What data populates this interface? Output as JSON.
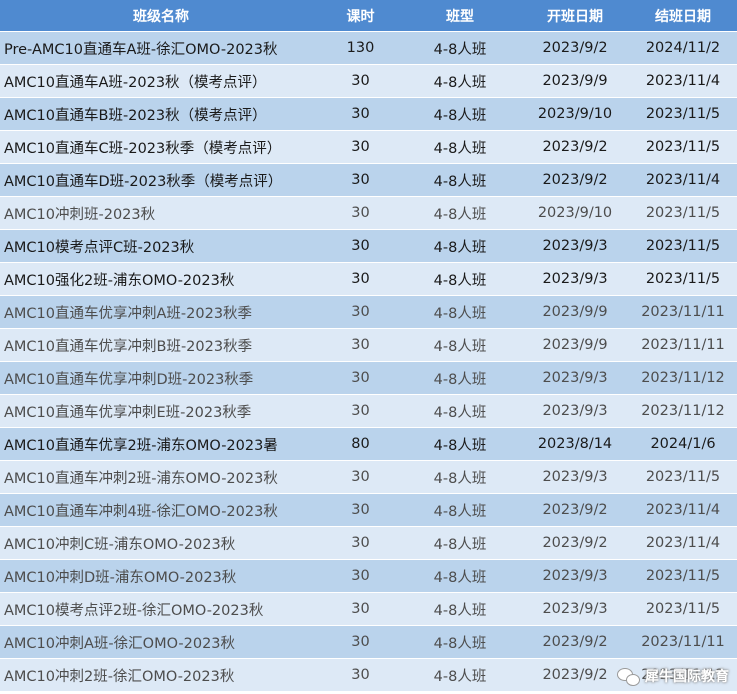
{
  "columns": [
    "班级名称",
    "课时",
    "班型",
    "开班日期",
    "结班日期"
  ],
  "rows": [
    {
      "name": "Pre-AMC10直通车A班-徐汇OMO-2023秋",
      "hours": "130",
      "type": "4-8人班",
      "start": "2023/9/2",
      "end": "2024/11/2"
    },
    {
      "name": "AMC10直通车A班-2023秋（模考点评）",
      "hours": "30",
      "type": "4-8人班",
      "start": "2023/9/9",
      "end": "2023/11/4"
    },
    {
      "name": "AMC10直通车B班-2023秋（模考点评）",
      "hours": "30",
      "type": "4-8人班",
      "start": "2023/9/10",
      "end": "2023/11/5"
    },
    {
      "name": "AMC10直通车C班-2023秋季（模考点评）",
      "hours": "30",
      "type": "4-8人班",
      "start": "2023/9/2",
      "end": "2023/11/5"
    },
    {
      "name": "AMC10直通车D班-2023秋季（模考点评）",
      "hours": "30",
      "type": "4-8人班",
      "start": "2023/9/2",
      "end": "2023/11/4"
    },
    {
      "name": "AMC10冲刺班-2023秋",
      "hours": "30",
      "type": "4-8人班",
      "start": "2023/9/10",
      "end": "2023/11/5"
    },
    {
      "name": "AMC10模考点评C班-2023秋",
      "hours": "30",
      "type": "4-8人班",
      "start": "2023/9/3",
      "end": "2023/11/5"
    },
    {
      "name": "AMC10强化2班-浦东OMO-2023秋",
      "hours": "30",
      "type": "4-8人班",
      "start": "2023/9/3",
      "end": "2023/11/5"
    },
    {
      "name": "AMC10直通车优享冲刺A班-2023秋季",
      "hours": "30",
      "type": "4-8人班",
      "start": "2023/9/9",
      "end": "2023/11/11"
    },
    {
      "name": "AMC10直通车优享冲刺B班-2023秋季",
      "hours": "30",
      "type": "4-8人班",
      "start": "2023/9/9",
      "end": "2023/11/11"
    },
    {
      "name": "AMC10直通车优享冲刺D班-2023秋季",
      "hours": "30",
      "type": "4-8人班",
      "start": "2023/9/3",
      "end": "2023/11/12"
    },
    {
      "name": "AMC10直通车优享冲刺E班-2023秋季",
      "hours": "30",
      "type": "4-8人班",
      "start": "2023/9/3",
      "end": "2023/11/12"
    },
    {
      "name": "AMC10直通车优享2班-浦东OMO-2023暑",
      "hours": "80",
      "type": "4-8人班",
      "start": "2023/8/14",
      "end": "2024/1/6"
    },
    {
      "name": "AMC10直通车冲刺2班-浦东OMO-2023秋",
      "hours": "30",
      "type": "4-8人班",
      "start": "2023/9/3",
      "end": "2023/11/5"
    },
    {
      "name": "AMC10直通车冲刺4班-徐汇OMO-2023秋",
      "hours": "30",
      "type": "4-8人班",
      "start": "2023/9/2",
      "end": "2023/11/4"
    },
    {
      "name": "AMC10冲刺C班-浦东OMO-2023秋",
      "hours": "30",
      "type": "4-8人班",
      "start": "2023/9/2",
      "end": "2023/11/4"
    },
    {
      "name": "AMC10冲刺D班-浦东OMO-2023秋",
      "hours": "30",
      "type": "4-8人班",
      "start": "2023/9/3",
      "end": "2023/11/5"
    },
    {
      "name": "AMC10模考点评2班-徐汇OMO-2023秋",
      "hours": "30",
      "type": "4-8人班",
      "start": "2023/9/3",
      "end": "2023/11/5"
    },
    {
      "name": "AMC10冲刺A班-徐汇OMO-2023秋",
      "hours": "30",
      "type": "4-8人班",
      "start": "2023/9/2",
      "end": "2023/11/11"
    },
    {
      "name": "AMC10冲刺2班-徐汇OMO-2023秋",
      "hours": "30",
      "type": "4-8人班",
      "start": "2023/9/2",
      "end": "2023/11/12"
    }
  ],
  "watermark": {
    "text": "犀牛国际教育",
    "icon": "wechat-icon"
  },
  "colors": {
    "header_bg": "#4f8ad0",
    "row_odd_bg": "#bad3ec",
    "row_even_bg": "#dde9f6"
  }
}
